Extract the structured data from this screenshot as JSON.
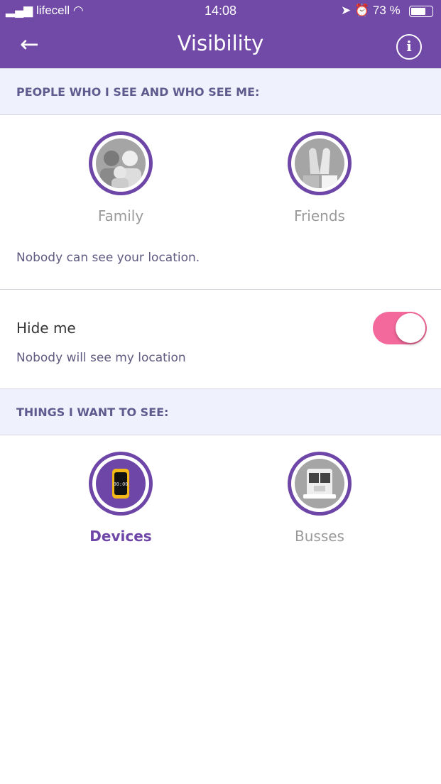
{
  "status_bar": {
    "carrier": "lifecell",
    "time": "14:08",
    "battery": "73 %"
  },
  "header": {
    "title": "Visibility"
  },
  "people_section": {
    "title": "PEOPLE WHO I SEE AND WHO SEE ME:",
    "items": [
      {
        "label": "Family",
        "selected": false
      },
      {
        "label": "Friends",
        "selected": false
      }
    ],
    "note": "Nobody can see your location."
  },
  "hide_me": {
    "label": "Hide me",
    "description": "Nobody will see my location",
    "enabled": true
  },
  "things_section": {
    "title": "THINGS I WANT TO SEE:",
    "items": [
      {
        "label": "Devices",
        "selected": true
      },
      {
        "label": "Busses",
        "selected": false
      }
    ]
  },
  "colors": {
    "primary": "#7149a6",
    "toggle_on": "#f4699b",
    "section_bg": "#eff1fc"
  }
}
